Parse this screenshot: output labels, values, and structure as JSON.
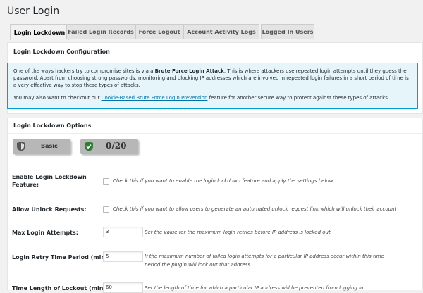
{
  "page": {
    "title": "User Login"
  },
  "tabs": [
    {
      "label": "Login Lockdown",
      "active": true
    },
    {
      "label": "Failed Login Records",
      "active": false
    },
    {
      "label": "Force Logout",
      "active": false
    },
    {
      "label": "Account Activity Logs",
      "active": false
    },
    {
      "label": "Logged In Users",
      "active": false
    }
  ],
  "config_section": {
    "title": "Login Lockdown Configuration"
  },
  "info": {
    "para1_prefix": "One of the ways hackers try to compromise sites is via a ",
    "para1_bold": "Brute Force Login Attack",
    "para1_suffix": ". This is where attackers use repeated login attempts until they guess the password. Apart from choosing strong passwords, monitoring and blocking IP addresses which are involved in repeated login failures in a short period of time is a very effective way to stop these types of attacks.",
    "para2_prefix": "You may also want to checkout our ",
    "para2_link": "Cookie-Based Brute Force Login Prevention",
    "para2_suffix": " feature for another secure way to protect against these types of attacks."
  },
  "options_section": {
    "title": "Login Lockdown Options"
  },
  "badges": {
    "level": "Basic",
    "score": "0/20"
  },
  "colors": {
    "info_border": "#00a0d2",
    "info_bg": "#e5f5fa",
    "link": "#0073aa"
  },
  "fields": {
    "enable_lockdown": {
      "label": "Enable Login Lockdown Feature:",
      "checked": false,
      "description": "Check this if you want to enable the login lockdown feature and apply the settings below"
    },
    "allow_unlock": {
      "label": "Allow Unlock Requests:",
      "checked": false,
      "description": "Check this if you want to allow users to generate an automated unlock request link which will unlock their account"
    },
    "max_attempts": {
      "label": "Max Login Attempts:",
      "value": "3",
      "description": "Set the value for the maximum login retries before IP address is locked out"
    },
    "retry_period": {
      "label": "Login Retry Time Period (min):",
      "value": "5",
      "description": "If the maximum number of failed login attempts for a particular IP address occur within this time period the plugin will lock out that address"
    },
    "lockout_length": {
      "label": "Time Length of Lockout (min):",
      "value": "60",
      "description": "Set the length of time for which a particular IP address will be prevented from logging in"
    }
  }
}
